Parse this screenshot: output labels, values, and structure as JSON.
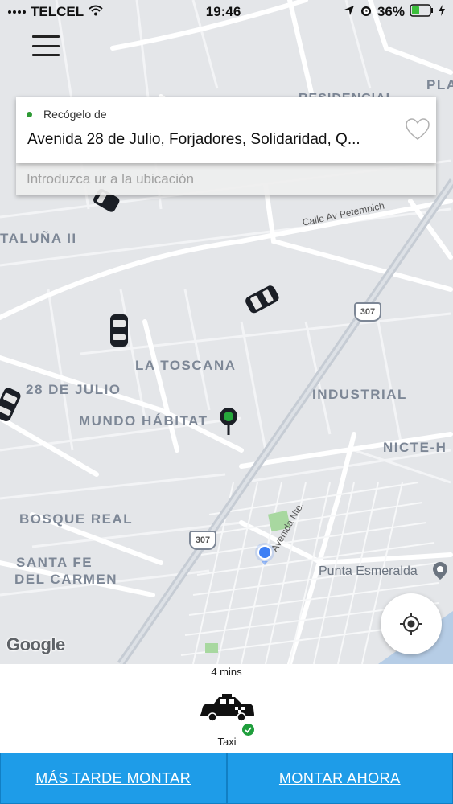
{
  "status_bar": {
    "carrier": "TELCEL",
    "time": "19:46",
    "battery": "36%",
    "icons": [
      "signal-icon",
      "wifi-icon",
      "location-arrow-icon",
      "alarm-icon",
      "battery-icon",
      "charging-bolt-icon"
    ]
  },
  "pickup": {
    "label": "Recógelo de",
    "address": "Avenida 28 de Julio, Forjadores, Solidaridad, Q...",
    "favorite_icon": "heart-icon"
  },
  "destination": {
    "placeholder": "Introduzca ur a la ubicación"
  },
  "map": {
    "neighborhoods": [
      "PLA",
      "RESIDENCIAL",
      "TALUÑA II",
      "LA TOSCANA",
      "28 DE JULIO",
      "MUNDO HÁBITAT",
      "INDUSTRIAL",
      "NICTE-H",
      "BOSQUE REAL",
      "SANTA FE",
      "DEL CARMEN"
    ],
    "streets": [
      "Calle Av Petempich",
      "Avenida Nte."
    ],
    "poi": "Punta Esmeralda",
    "highway": "307",
    "attribution": "Google"
  },
  "ride": {
    "eta": "4 mins",
    "vehicle_label": "Taxi"
  },
  "actions": {
    "later": "MÁS TARDE MONTAR",
    "now": "MONTAR AHORA"
  },
  "colors": {
    "accent": "#1e9ce8",
    "pickup_dot": "#2e9a35",
    "user_location": "#3d7ff5"
  }
}
